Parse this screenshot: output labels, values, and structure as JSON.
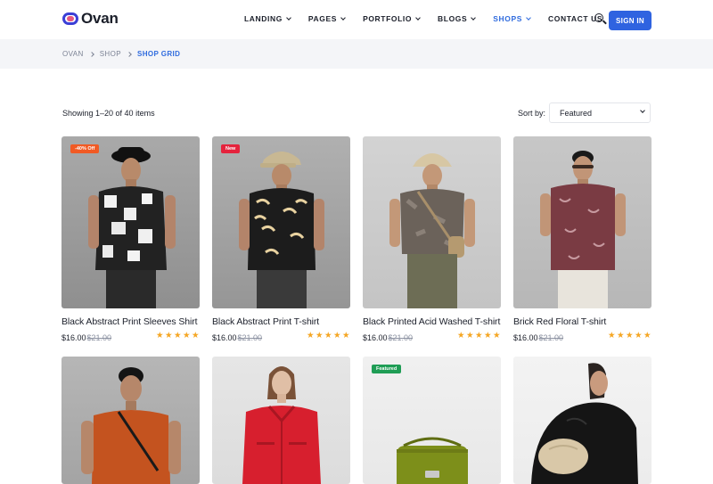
{
  "brand": {
    "name": "Ovan"
  },
  "nav": {
    "items": [
      {
        "label": "LANDING",
        "has_dropdown": true,
        "active": false
      },
      {
        "label": "PAGES",
        "has_dropdown": true,
        "active": false
      },
      {
        "label": "PORTFOLIO",
        "has_dropdown": true,
        "active": false
      },
      {
        "label": "BLOGS",
        "has_dropdown": true,
        "active": false
      },
      {
        "label": "SHOPS",
        "has_dropdown": true,
        "active": true
      },
      {
        "label": "CONTACT US",
        "has_dropdown": false,
        "active": false
      }
    ],
    "search_icon": "search-icon",
    "signin_label": "SIGN IN"
  },
  "breadcrumb": [
    "OVAN",
    "SHOP",
    "SHOP GRID"
  ],
  "toolbar": {
    "showing": "Showing 1–20 of 40 items",
    "sort_label": "Sort by:",
    "sort_value": "Featured"
  },
  "colors": {
    "accent": "#2f63e0",
    "badge_sale": "#f15a24",
    "badge_new": "#e5233d",
    "badge_featured": "#1f9d55",
    "star": "#f5a623"
  },
  "products": [
    {
      "name": "Black Abstract Print Sleeves Shirt",
      "price": "$16.00",
      "old_price": "$21.00",
      "rating": 5,
      "badge": "-40% Off",
      "badge_type": "sale"
    },
    {
      "name": "Black Abstract Print T-shirt",
      "price": "$16.00",
      "old_price": "$21.00",
      "rating": 5,
      "badge": "New",
      "badge_type": "new"
    },
    {
      "name": "Black Printed Acid Washed T-shirt",
      "price": "$16.00",
      "old_price": "$21.00",
      "rating": 5,
      "badge": "",
      "badge_type": ""
    },
    {
      "name": "Brick Red Floral T-shirt",
      "price": "$16.00",
      "old_price": "$21.00",
      "rating": 5,
      "badge": "",
      "badge_type": ""
    },
    {
      "name": "",
      "price": "",
      "old_price": "",
      "rating": 0,
      "badge": "",
      "badge_type": ""
    },
    {
      "name": "",
      "price": "",
      "old_price": "",
      "rating": 0,
      "badge": "",
      "badge_type": ""
    },
    {
      "name": "",
      "price": "",
      "old_price": "",
      "rating": 0,
      "badge": "Featured",
      "badge_type": "featured"
    },
    {
      "name": "",
      "price": "",
      "old_price": "",
      "rating": 0,
      "badge": "",
      "badge_type": ""
    }
  ]
}
